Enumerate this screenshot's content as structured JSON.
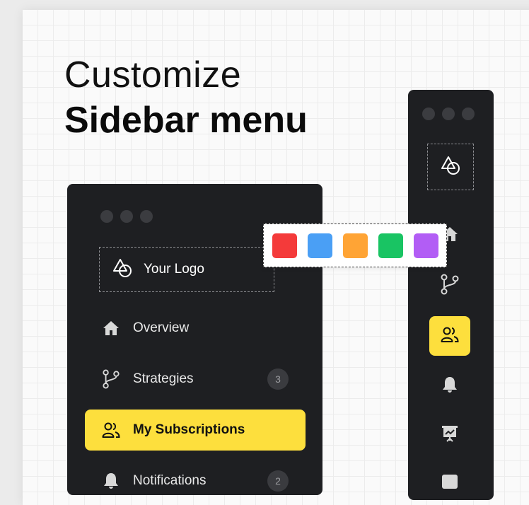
{
  "heading": {
    "line1": "Customize",
    "line2": "Sidebar menu"
  },
  "sidebar": {
    "logo_label": "Your Logo",
    "items": [
      {
        "label": "Overview",
        "icon": "home-icon",
        "badge": null,
        "active": false
      },
      {
        "label": "Strategies",
        "icon": "branch-icon",
        "badge": "3",
        "active": false
      },
      {
        "label": "My Subscriptions",
        "icon": "users-icon",
        "badge": null,
        "active": true
      },
      {
        "label": "Notifications",
        "icon": "bell-icon",
        "badge": "2",
        "active": false
      }
    ]
  },
  "palette": {
    "colors": [
      "#f43a3a",
      "#4a9ff5",
      "#ffa435",
      "#19c463",
      "#b25df5"
    ]
  },
  "rail": {
    "icons": [
      "home-icon",
      "branch-icon",
      "users-icon",
      "bell-icon",
      "presentation-icon",
      "inbox-icon"
    ],
    "active_index": 2
  },
  "theme": {
    "accent": "#fddf3d",
    "panel": "#1e1f22"
  }
}
